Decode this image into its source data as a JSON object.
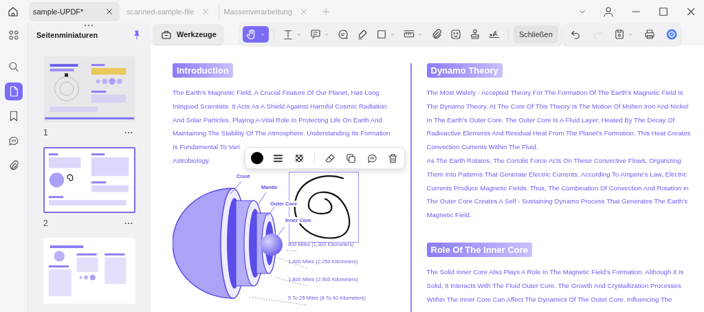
{
  "tabs": [
    {
      "label": "sample-UPDF*",
      "selected": true
    },
    {
      "label": "scanned-sample-file",
      "selected": false
    },
    {
      "label": "Massenverarbeitung",
      "selected": false
    }
  ],
  "rail": [
    {
      "kind": "grid",
      "selected": false
    },
    {
      "kind": "search",
      "selected": false
    },
    {
      "kind": "page",
      "selected": true
    },
    {
      "kind": "bookmark",
      "selected": false
    },
    {
      "kind": "comment",
      "selected": false
    },
    {
      "kind": "paperclip",
      "selected": false
    }
  ],
  "thumbnail_panel": {
    "title": "Seitenminiaturen",
    "pages": [
      {
        "number": "1",
        "selected": false,
        "kind": "cover"
      },
      {
        "number": "2",
        "selected": true,
        "kind": "layers"
      },
      {
        "selected": false,
        "kind": "theories"
      }
    ]
  },
  "toolbar": {
    "tools_button": "Werkzeuge",
    "tools": [
      {
        "kind": "hand",
        "selected": true,
        "dropdown": true
      },
      {
        "kind": "text",
        "selected": false,
        "dropdown": true
      },
      {
        "kind": "note",
        "selected": false,
        "dropdown": true
      },
      {
        "kind": "bubble",
        "selected": false,
        "dropdown": false
      },
      {
        "kind": "pen",
        "selected": false,
        "dropdown": false
      },
      {
        "kind": "square",
        "selected": false,
        "dropdown": true
      },
      {
        "kind": "ruler",
        "selected": false,
        "dropdown": true
      },
      {
        "kind": "paperclip",
        "selected": false,
        "dropdown": false
      },
      {
        "kind": "sticker",
        "selected": false,
        "dropdown": false
      },
      {
        "kind": "stamp",
        "selected": false,
        "dropdown": false
      },
      {
        "kind": "signature",
        "selected": false,
        "dropdown": false
      }
    ],
    "close_button": "Schließen",
    "actions": [
      {
        "kind": "undo",
        "disabled": false,
        "dropdown": false
      },
      {
        "kind": "redo",
        "disabled": true,
        "dropdown": false
      },
      {
        "kind": "save",
        "disabled": false,
        "dropdown": true
      },
      {
        "kind": "print",
        "disabled": false,
        "dropdown": false
      },
      {
        "kind": "ai",
        "disabled": false,
        "dropdown": false
      }
    ]
  },
  "document": {
    "left": {
      "heading": "Introduction",
      "lines": [
        "The Earth's Magnetic Field, A Crucial Feature Of Our Planet, Has Long",
        "Intrigued Scientists. It Acts As A Shield Against Harmful Cosmic Radiation",
        "And Solar Particles, Playing A Vital Role In Protecting Life On Earth And",
        "Maintaining The Stability Of The Atmosphere. Understanding Its Formation",
        "Is Fundamental To Vari",
        "Astrobiology."
      ],
      "diagram": {
        "layers": [
          "Crust",
          "Mantle",
          "Outer Core",
          "Inner Core"
        ],
        "distances": [
          "800 Miles (1,300 Kilometers)",
          "1,400 Miles (2,250 Kilometers)",
          "1,800 Miles (2,900 Kilometers)",
          "5 To 25 Miles (8 To 40 Kilometers)"
        ]
      }
    },
    "right": [
      {
        "heading": "Dynamo Theory",
        "paragraphs": [
          [
            "The Most Widely - Accepted Theory For The Formation Of The Earth's Magnetic Field Is",
            "The Dynamo Theory. At The Core Of This Theory Is The Motion Of Molten Iron And Nickel",
            "In The Earth's Outer Core. The Outer Core Is A Fluid Layer, Heated By The Decay Of",
            "Radioactive Elements And Residual Heat From The Planet's Formation. This Heat Creates",
            "Convection Currents Within The Fluid."
          ],
          [
            "As The Earth Rotates, The Coriolis Force Acts On These Convective Flows, Organizing",
            "Them Into Patterns That Generate Electric Currents. According To Ampere's Law, Electric",
            "Currents Produce Magnetic Fields. Thus, The Combination Of Convection And Rotation in",
            "The Outer Core Creates A Self - Sustaining Dynamo Process That Generates The Earth's",
            "Magnetic Field."
          ]
        ]
      },
      {
        "heading": "Role Of The Inner Core",
        "paragraphs": [
          [
            "The Solid Inner Core Also Plays A Role In The Magnetic Field's Formation. Although It Is",
            "Solid, It Interacts With The Fluid Outer Core. The Growth And Crystallization Processes",
            "Within The Inner Core Can Affect The Dynamics Of The Outer Core. Influencing The"
          ]
        ]
      }
    ]
  },
  "annotation_toolbar": {
    "color": "#000000",
    "tools": [
      {
        "kind": "stroke"
      },
      {
        "kind": "opacity"
      },
      {
        "kind": "eraser"
      },
      {
        "kind": "copy"
      },
      {
        "kind": "comment"
      },
      {
        "kind": "delete"
      }
    ]
  }
}
